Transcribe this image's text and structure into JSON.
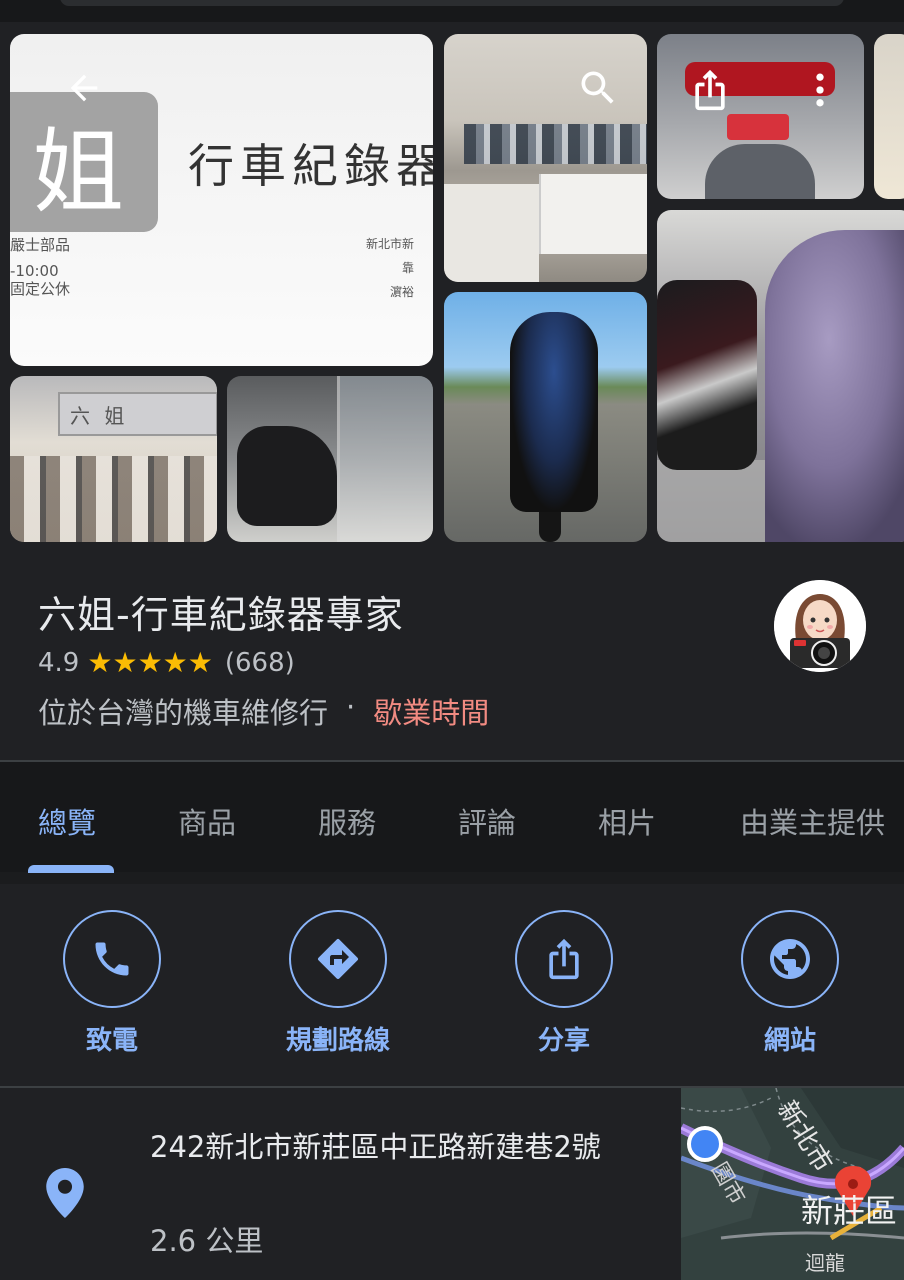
{
  "gallery": {
    "sign_logo_char": "姐",
    "sign_title": "行車紀錄器",
    "sign_left_lines": [
      "嚴士部品",
      "-10:00",
      "固定公休"
    ],
    "sign_right_lines": [
      "新北市新",
      "靠",
      "濵裕"
    ],
    "storefront_sign": "六 姐"
  },
  "place": {
    "name": "六姐-行車紀錄器專家",
    "rating": "4.9",
    "stars": "★★★★★",
    "review_count": "(668)",
    "category": "位於台灣的機車維修行",
    "separator": "·",
    "hours_label": "歇業時間"
  },
  "tabs": [
    {
      "label": "總覽"
    },
    {
      "label": "商品"
    },
    {
      "label": "服務"
    },
    {
      "label": "評論"
    },
    {
      "label": "相片"
    },
    {
      "label": "由業主提供"
    }
  ],
  "actions": [
    {
      "label": "致電",
      "icon": "phone-icon"
    },
    {
      "label": "規劃路線",
      "icon": "directions-icon"
    },
    {
      "label": "分享",
      "icon": "share-icon"
    },
    {
      "label": "網站",
      "icon": "globe-icon"
    }
  ],
  "address": {
    "line": "242新北市新莊區中正路新建巷2號",
    "distance": "2.6 公里"
  },
  "map": {
    "labels": [
      "新北市",
      "新莊區",
      "迴龍",
      "園市"
    ]
  },
  "colors": {
    "accent": "#8ab4f8",
    "star": "#fbbc04",
    "hours_red": "#f28b82",
    "background": "#202124"
  }
}
